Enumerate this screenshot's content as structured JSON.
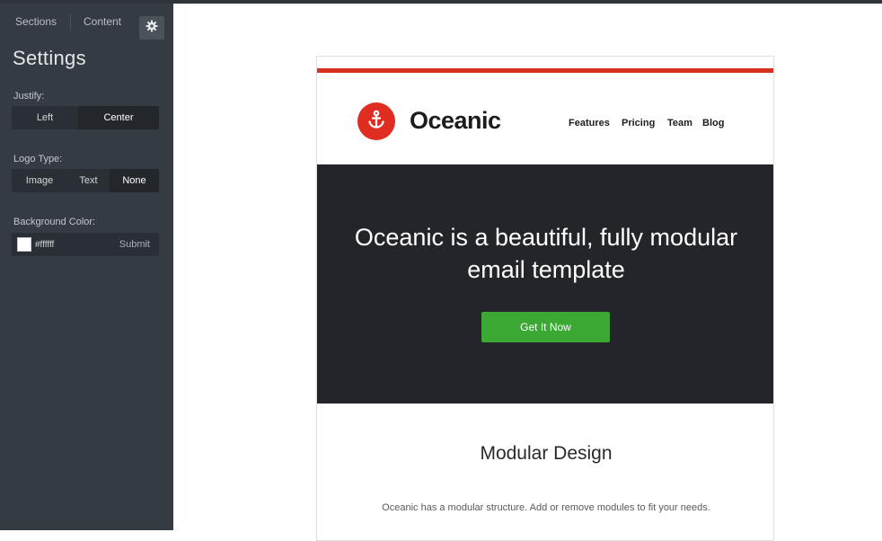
{
  "sidebar": {
    "tabs": {
      "sections": "Sections",
      "content": "Content"
    },
    "settings_icon": "gear-icon",
    "title": "Settings",
    "justify": {
      "label": "Justify:",
      "options": [
        "Left",
        "Center"
      ],
      "selected": "Center"
    },
    "logo_type": {
      "label": "Logo Type:",
      "options": [
        "Image",
        "Text",
        "None"
      ],
      "selected": "None"
    },
    "background_color": {
      "label": "Background Color:",
      "value": "#ffffff",
      "submit": "Submit"
    }
  },
  "email": {
    "brand": "Oceanic",
    "logo_icon": "anchor-icon",
    "nav": [
      "Features",
      "Pricing",
      "Team",
      "Blog"
    ],
    "hero": {
      "title_line1": "Oceanic is a beautiful, fully modular",
      "title_line2": "email template",
      "button": "Get It Now"
    },
    "section": {
      "title": "Modular Design",
      "text": "Oceanic has a modular structure. Add or remove modules to fit your needs."
    }
  },
  "colors": {
    "sidebar_bg": "#353b42",
    "accent_red": "#e02d21",
    "hero_bg": "#24252a",
    "button_green": "#3aa833"
  }
}
